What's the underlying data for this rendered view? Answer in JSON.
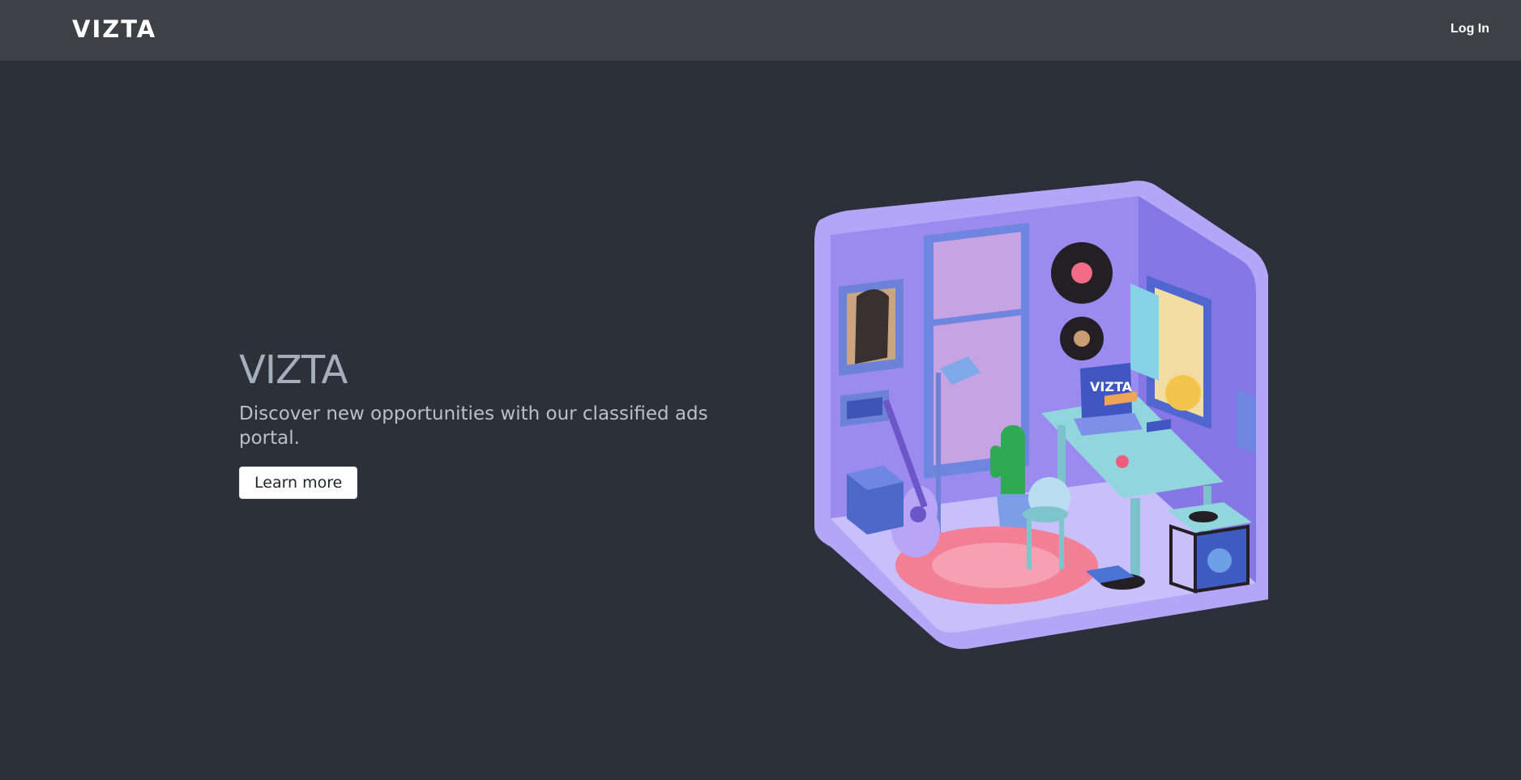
{
  "navbar": {
    "brand": "VIZTA",
    "login_label": "Log In"
  },
  "hero": {
    "title": "VIZTA",
    "subtitle": "Discover new opportunities with our classified ads portal.",
    "button_label": "Learn more"
  },
  "illustration": {
    "laptop_text": "VIZTA"
  },
  "colors": {
    "page_background": "#2b303b",
    "navbar_background": "#3f4045",
    "room_wall": "#9c8cf0",
    "room_floor": "#b9adf8",
    "rug": "#f27f95",
    "desk": "#8fd3d8"
  }
}
